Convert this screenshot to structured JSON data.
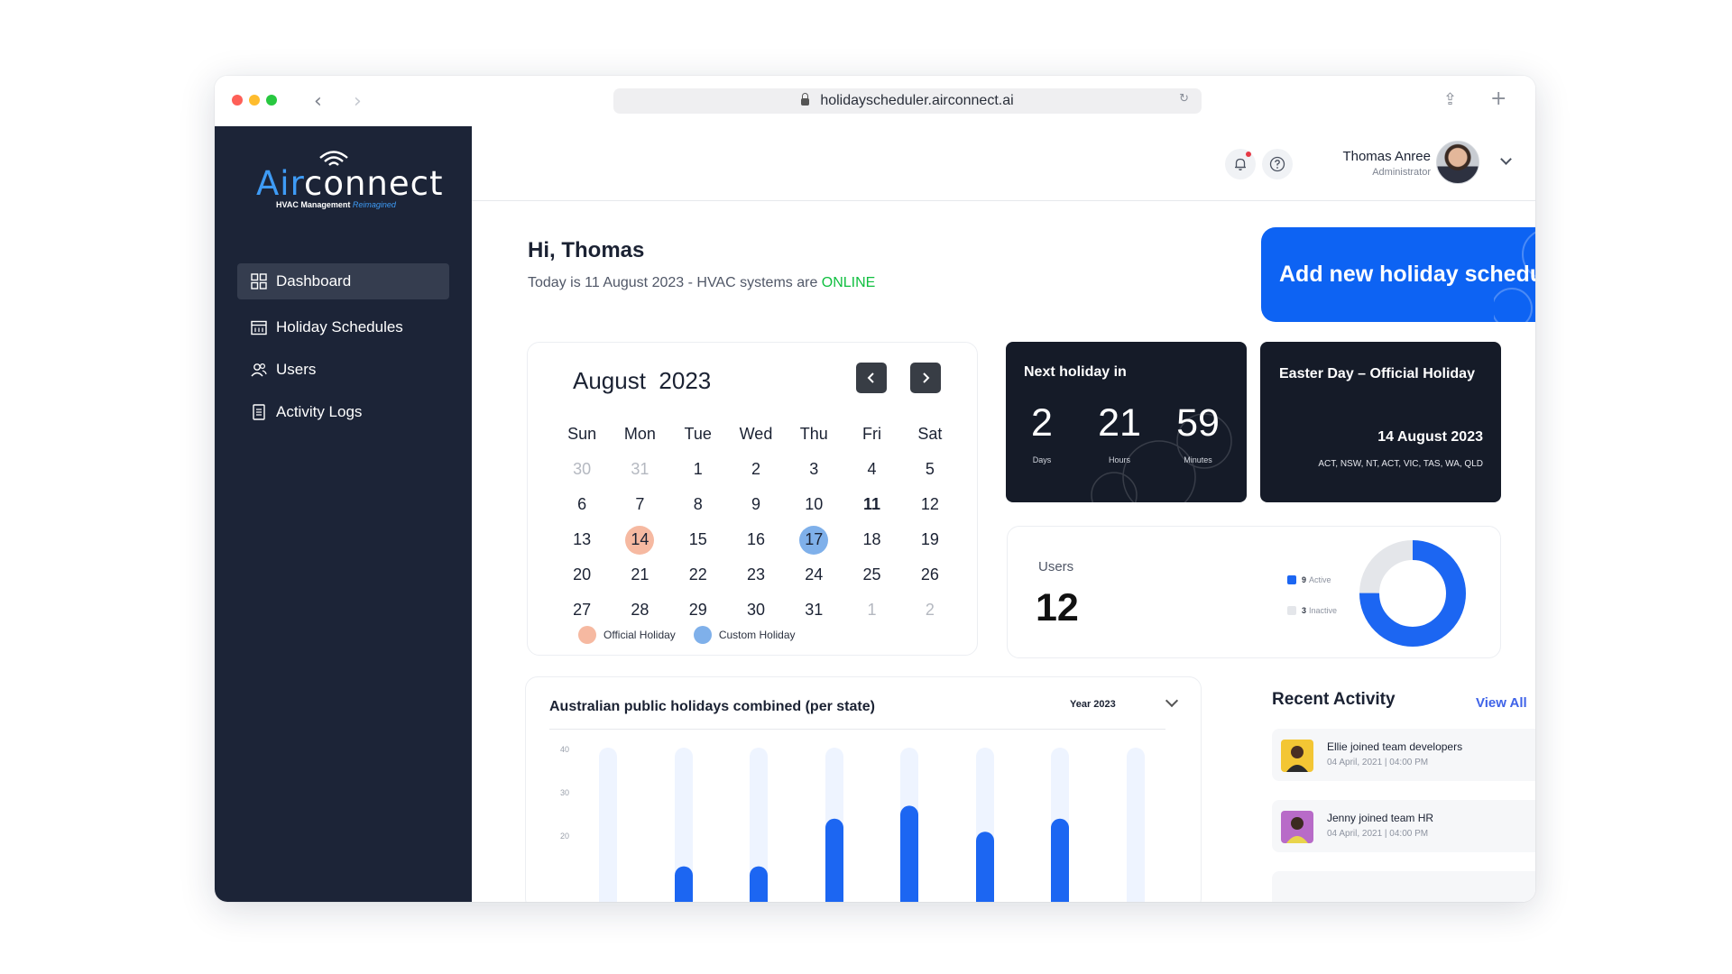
{
  "browser": {
    "url": "holidayscheduler.airconnect.ai"
  },
  "brand": {
    "name_air": "Air",
    "name_rest": "connect",
    "tagline": "HVAC Management",
    "tagline_accent": "Reimagined",
    "accent_color": "#3e9bf5"
  },
  "sidebar": {
    "items": [
      {
        "label": "Dashboard",
        "icon": "grid-icon",
        "active": true
      },
      {
        "label": "Holiday Schedules",
        "icon": "calendar-icon",
        "active": false
      },
      {
        "label": "Users",
        "icon": "users-icon",
        "active": false
      },
      {
        "label": "Activity Logs",
        "icon": "document-icon",
        "active": false
      }
    ]
  },
  "header": {
    "user_name": "Thomas Anree",
    "user_role": "Administrator"
  },
  "greeting": {
    "title": "Hi, Thomas",
    "status_prefix": "Today is 11 August 2023 - HVAC systems are ",
    "status_value": "ONLINE",
    "status_color": "#0fbf3f"
  },
  "add_card": {
    "label": "Add new holiday schedule",
    "color": "#0d63f3"
  },
  "calendar": {
    "month": "August",
    "year": "2023",
    "weekdays": [
      "Sun",
      "Mon",
      "Tue",
      "Wed",
      "Thu",
      "Fri",
      "Sat"
    ],
    "weeks": [
      [
        "30",
        "31",
        "1",
        "2",
        "3",
        "4",
        "5"
      ],
      [
        "6",
        "7",
        "8",
        "9",
        "10",
        "11",
        "12"
      ],
      [
        "13",
        "14",
        "15",
        "16",
        "17",
        "18",
        "19"
      ],
      [
        "20",
        "21",
        "22",
        "23",
        "24",
        "25",
        "26"
      ],
      [
        "27",
        "28",
        "29",
        "30",
        "31",
        "1",
        "2"
      ]
    ],
    "today": "11",
    "official_holidays": [
      "14"
    ],
    "custom_holidays": [
      "17"
    ],
    "legend_official": "Official Holiday",
    "legend_custom": "Custom Holiday",
    "official_color": "#f6b9a1",
    "custom_color": "#7fb0ea"
  },
  "next_holiday": {
    "label": "Next holiday in",
    "days": "2",
    "days_label": "Days",
    "hours": "21",
    "hours_label": "Hours",
    "minutes": "59",
    "minutes_label": "Minutes"
  },
  "upcoming": {
    "title": "Easter Day – Official Holiday",
    "date": "14 August 2023",
    "states": "ACT, NSW, NT, ACT, VIC, TAS, WA, QLD"
  },
  "users": {
    "label": "Users",
    "total": "12",
    "active_count": "9",
    "active_label": "Active",
    "inactive_count": "3",
    "inactive_label": "Inactive",
    "active_color": "#1c66f2",
    "inactive_color": "#e4e6ea"
  },
  "chart": {
    "title": "Australian public holidays combined (per state)",
    "period": "Year 2023"
  },
  "chart_data": {
    "type": "bar",
    "title": "Australian public holidays combined (per state)",
    "xlabel": "",
    "ylabel": "",
    "ylim": [
      0,
      40
    ],
    "y_ticks": [
      "40",
      "30",
      "20"
    ],
    "values": [
      0,
      13,
      13,
      24,
      27,
      21,
      24,
      0
    ],
    "bar_color": "#1c66f2",
    "track_color": "#eef4ff"
  },
  "recent_activity": {
    "title": "Recent Activity",
    "view_all": "View All",
    "items": [
      {
        "text": "Ellie joined team developers",
        "time": "04 April, 2021 | 04:00 PM",
        "avatar_color": "#f3c634"
      },
      {
        "text": "Jenny joined team HR",
        "time": "04 April, 2021 | 04:00 PM",
        "avatar_color": "#b86bc8"
      }
    ]
  }
}
